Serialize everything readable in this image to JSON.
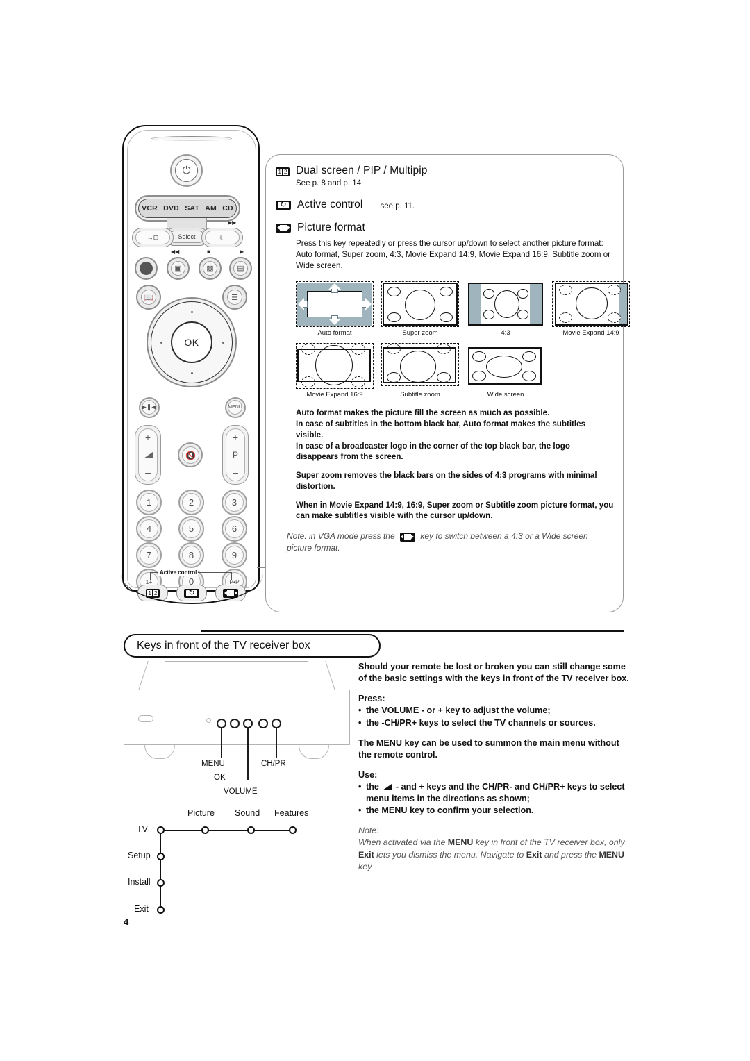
{
  "page": {
    "number": "4"
  },
  "remote": {
    "power_icon": "power-icon",
    "source_bar": [
      "VCR",
      "DVD",
      "SAT",
      "AM",
      "CD"
    ],
    "select_label": "Select",
    "ok_label": "OK",
    "menu_label": "MENU",
    "program_label": "P",
    "plus": "+",
    "minus": "–",
    "mini_labels": {
      "ffwd": "▶▶",
      "rew": "◀◀",
      "stop": "■",
      "play": "▶"
    },
    "numbers": [
      "1",
      "2",
      "3",
      "4",
      "5",
      "6",
      "7",
      "8",
      "9",
      "0"
    ],
    "list_key": "1+",
    "pip_key": "P•P",
    "active_control_bracket_label": "Active control",
    "function_keys": [
      "dual-screen-key",
      "active-control-key",
      "picture-format-key"
    ]
  },
  "panel": {
    "items": [
      {
        "icon": "dual-screen-icon",
        "title": "Dual screen / PIP / Multipip",
        "sub": "See p. 8 and p. 14."
      },
      {
        "icon": "active-control-icon",
        "title": "Active control",
        "sub": "see p. 11."
      },
      {
        "icon": "picture-format-icon",
        "title": "Picture format",
        "sub": ""
      }
    ],
    "picture_format_intro": "Press this key repeatedly or press the cursor up/down to select another picture format: Auto format, Super zoom, 4:3, Movie Expand 14:9, Movie Expand 16:9, Subtitle zoom or Wide screen.",
    "formats_row1": [
      "Auto format",
      "Super zoom",
      "4:3",
      "Movie Expand 14:9"
    ],
    "formats_row2": [
      "Movie Expand 16:9",
      "Subtitle zoom",
      "Wide screen"
    ],
    "paragraphs": [
      "Auto format makes the picture fill the screen as much as possible.",
      "In case of subtitles in the bottom black bar, Auto format makes the subtitles visible.",
      "In case of a broadcaster logo in the corner of the top black bar, the logo disappears from the screen.",
      "Super zoom removes the black bars on the sides of 4:3 programs with minimal distortion.",
      "When in Movie Expand 14:9, 16:9, Super zoom or Subtitle zoom picture format, you can make subtitles visible with the cursor up/down."
    ],
    "note_before": "Note: in VGA mode press the",
    "note_after": "key to switch between a 4:3 or a Wide screen picture format."
  },
  "section": {
    "title": "Keys in front of the TV receiver box"
  },
  "receiver": {
    "key_labels": {
      "menu": "MENU",
      "ok": "OK",
      "chpr": "CH/PR",
      "volume": "VOLUME"
    }
  },
  "tree": {
    "row_nodes": [
      "TV",
      "Picture",
      "Sound",
      "Features"
    ],
    "col_nodes": [
      "Setup",
      "Install",
      "Exit"
    ]
  },
  "rightcol": {
    "intro": "Should your remote be lost or broken you can still change some of the basic settings with the keys in front of the TV receiver box.",
    "press_label": "Press:",
    "press_items": [
      "the VOLUME - or + key to adjust the volume;",
      "the -CH/PR+ keys to select the TV channels or sources."
    ],
    "menu_para": "The MENU  key can be used to summon the main menu without the remote control.",
    "use_label": "Use:",
    "use_item_1a": "the",
    "use_item_1b": "- and + keys and the CH/PR- and CH/PR+ keys to select menu items in the directions as shown;",
    "use_item_2": "the MENU  key to confirm your selection.",
    "note_label": "Note:",
    "note_line1_a": "When activated via the ",
    "note_line1_b": "MENU",
    "note_line1_c": " key in front of the TV receiver box, only ",
    "note_line1_d": "Exit",
    "note_line1_e": " lets you dismiss the menu.",
    "note_line2_a": "Navigate to ",
    "note_line2_b": "Exit",
    "note_line2_c": " and press the ",
    "note_line2_d": "MENU",
    "note_line2_e": " key."
  },
  "colors": {
    "ink": "#111111",
    "diagram_fill": "#9fb4bd",
    "line_gray": "#b3b3b3",
    "note_gray": "#555555"
  }
}
